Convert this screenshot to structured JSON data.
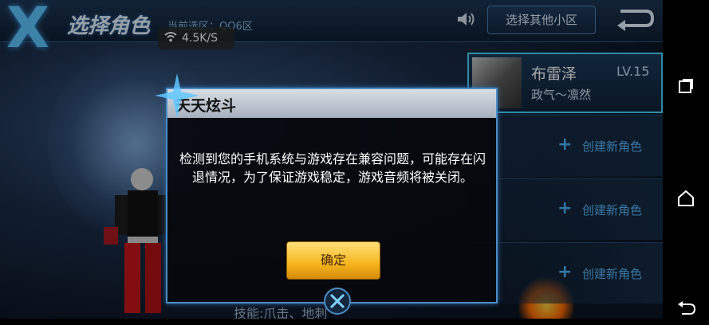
{
  "header": {
    "logo_glyph": "X",
    "title": "选择角色",
    "server": "当前选区：QQ6区",
    "network_speed": "4.5K/S",
    "other_server_button": "选择其他小区"
  },
  "character": {
    "name": "布雷泽",
    "level": "LV.15",
    "class": "政气～凛然"
  },
  "slots": [
    {
      "label": "创建新角色"
    },
    {
      "label": "创建新角色"
    },
    {
      "label": "创建新角色"
    }
  ],
  "bottom_text": "技能:爪击、地刺",
  "dialog": {
    "title": "天天炫斗",
    "message": "检测到您的手机系统与游戏存在兼容问题，可能存在闪退情况，为了保证游戏稳定，游戏音频将被关闭。",
    "confirm_button": "确定"
  },
  "colors": {
    "accent": "#46d8ff",
    "confirm": "#f6b51d"
  }
}
